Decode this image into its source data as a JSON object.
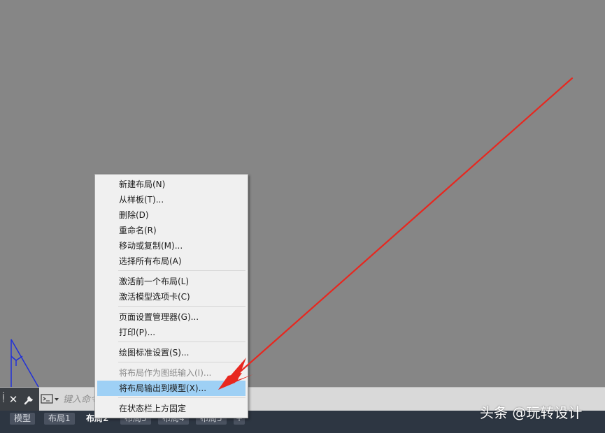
{
  "menu": {
    "items": [
      {
        "label": "新建布局(N)",
        "enabled": true,
        "highlighted": false
      },
      {
        "label": "从样板(T)...",
        "enabled": true,
        "highlighted": false
      },
      {
        "label": "删除(D)",
        "enabled": true,
        "highlighted": false
      },
      {
        "label": "重命名(R)",
        "enabled": true,
        "highlighted": false
      },
      {
        "label": "移动或复制(M)...",
        "enabled": true,
        "highlighted": false
      },
      {
        "label": "选择所有布局(A)",
        "enabled": true,
        "highlighted": false
      },
      {
        "label": "激活前一个布局(L)",
        "enabled": true,
        "highlighted": false
      },
      {
        "label": "激活模型选项卡(C)",
        "enabled": true,
        "highlighted": false
      },
      {
        "label": "页面设置管理器(G)...",
        "enabled": true,
        "highlighted": false
      },
      {
        "label": "打印(P)...",
        "enabled": true,
        "highlighted": false
      },
      {
        "label": "绘图标准设置(S)...",
        "enabled": true,
        "highlighted": false
      },
      {
        "label": "将布局作为图纸输入(I)...",
        "enabled": false,
        "highlighted": false
      },
      {
        "label": "将布局输出到模型(X)...",
        "enabled": true,
        "highlighted": true
      },
      {
        "label": "在状态栏上方固定",
        "enabled": true,
        "highlighted": false
      }
    ]
  },
  "command_line": {
    "placeholder": "键入命令"
  },
  "tabs": [
    {
      "label": "模型",
      "active": false
    },
    {
      "label": "布局1",
      "active": false
    },
    {
      "label": "布局2",
      "active": true
    },
    {
      "label": "布局3",
      "active": false
    },
    {
      "label": "布局4",
      "active": false
    },
    {
      "label": "布局5",
      "active": false
    }
  ],
  "tab_add_label": "+",
  "watermark": "头条 @玩转设计",
  "icons": {
    "close": "close-icon",
    "wrench": "wrench-icon",
    "command_prompt": "command-prompt-icon",
    "grip": "grip-icon",
    "ucs": "ucs-icon"
  },
  "colors": {
    "canvas": "#868686",
    "menu_bg": "#f0f0f0",
    "menu_highlight": "#9ed0f5",
    "arrow": "#e8271f",
    "tabbar": "#2d3642"
  }
}
